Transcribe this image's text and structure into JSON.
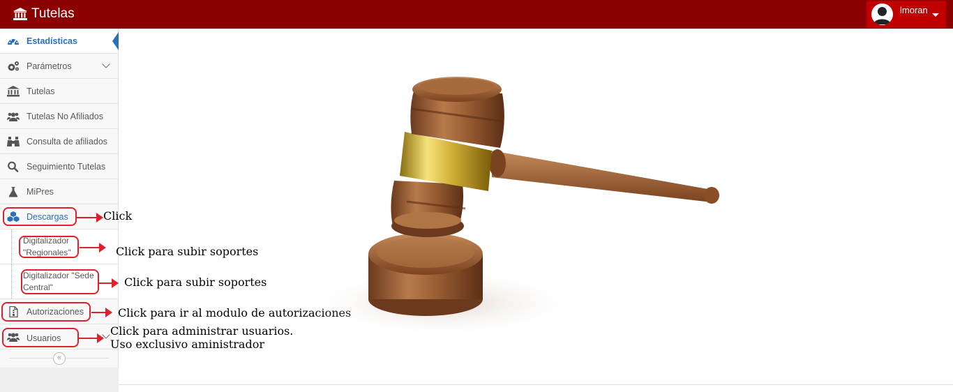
{
  "app": {
    "title": "Tutelas"
  },
  "user": {
    "name": "lmoran"
  },
  "colors": {
    "topbar": "#8b0000",
    "user_box": "#c00000",
    "accent": "#2b6fb6",
    "annotation": "#e0202a"
  },
  "sidebar": {
    "items": [
      {
        "label": "Estadísticas",
        "icon": "dashboard-icon",
        "active": true
      },
      {
        "label": "Parámetros",
        "icon": "cogs-icon",
        "expandable": true
      },
      {
        "label": "Tutelas",
        "icon": "bank-icon"
      },
      {
        "label": "Tutelas No Afiliados",
        "icon": "users-icon"
      },
      {
        "label": "Consulta de afiliados",
        "icon": "binoculars-icon"
      },
      {
        "label": "Seguimiento Tutelas",
        "icon": "search-icon"
      },
      {
        "label": "MiPres",
        "icon": "flask-icon"
      },
      {
        "label": "Descargas",
        "icon": "cubes-icon",
        "expanded": true
      },
      {
        "label": "Autorizaciones",
        "icon": "file-icon"
      },
      {
        "label": "Usuarios",
        "icon": "group-icon",
        "expandable": true
      }
    ],
    "subitems": [
      {
        "label": "Digitalizador \"Regionales\""
      },
      {
        "label": "Digitalizador \"Sede Central\""
      }
    ],
    "collapse_label": "«"
  },
  "annotations": {
    "descargas": "Click",
    "regionales": "Click para subir soportes",
    "sede_central": "Click para subir soportes",
    "autorizaciones": "Click para ir al modulo de autorizaciones",
    "usuarios_line1": "Click para administrar usuarios.",
    "usuarios_line2": "Uso exclusivo aministrador"
  },
  "main": {
    "image": "gavel-image"
  }
}
